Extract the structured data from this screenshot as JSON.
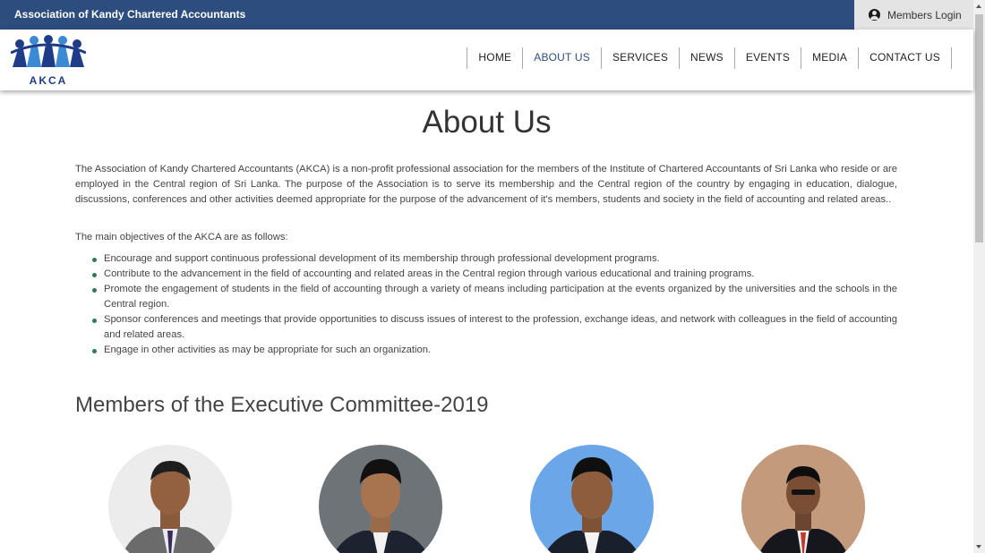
{
  "topbar": {
    "org_name": "Association of Kandy Chartered Accountants",
    "login_label": "Members Login",
    "bg_color": "#2e4d7f"
  },
  "logo": {
    "brand": "AKCA"
  },
  "nav": {
    "items": [
      {
        "label": "HOME"
      },
      {
        "label": "ABOUT US",
        "active": true
      },
      {
        "label": "SERVICES"
      },
      {
        "label": "NEWS"
      },
      {
        "label": "EVENTS"
      },
      {
        "label": "MEDIA"
      },
      {
        "label": "CONTACT US"
      }
    ]
  },
  "main": {
    "title": "About Us",
    "intro": "The Association of Kandy Chartered Accountants (AKCA) is a non-profit professional association for the members of the Institute of Chartered Accountants of Sri Lanka who reside or are employed in the Central region of Sri Lanka. The purpose of the Association is to serve its membership and the Central region of the country by engaging in education, dialogue, discussions, conferences and other activities deemed appropriate for the purpose of the advancement of it's members, students and society in the field of accounting and related areas..",
    "objectives_intro": "The main objectives of the AKCA are as follows:",
    "objectives": [
      "Encourage and support continuous professional development of its membership through professional development programs.",
      "Contribute to the advancement in the field of accounting and related areas in the Central region through various educational and training programs.",
      "Promote the engagement of students in the field of accounting through a variety of means including participation at the events organized by the universities and the schools in the Central region.",
      "Sponsor conferences and meetings that provide opportunities to discuss issues of interest to the profession, exchange ideas, and network with colleagues in the field of accounting and related areas.",
      "Engage in other activities as may be appropriate for such an organization."
    ],
    "committee_title": "Members of the Executive Committee-2019"
  },
  "colors": {
    "accent": "#2e4d7f",
    "bullet": "#2e7d4f"
  }
}
